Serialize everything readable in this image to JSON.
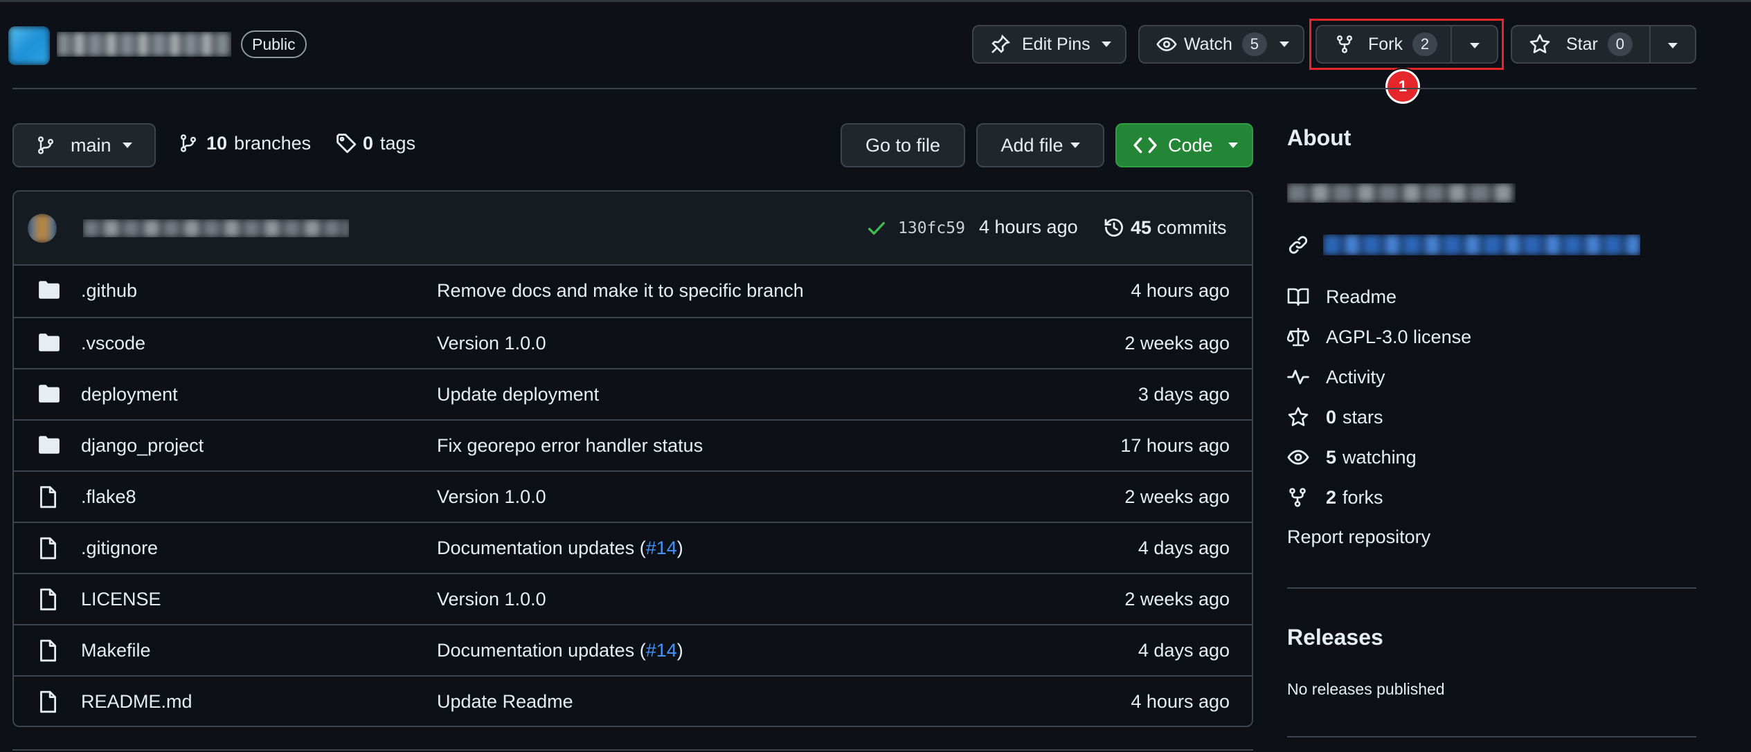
{
  "repo": {
    "visibility": "Public"
  },
  "header_actions": {
    "edit_pins": "Edit Pins",
    "watch": "Watch",
    "watch_count": "5",
    "fork": "Fork",
    "fork_count": "2",
    "star": "Star",
    "star_count": "0"
  },
  "annotation_marker": "1",
  "toolbar": {
    "branch": "main",
    "branches_count": "10",
    "branches_label": "branches",
    "tags_count": "0",
    "tags_label": "tags",
    "go_to_file": "Go to file",
    "add_file": "Add file",
    "code": "Code"
  },
  "commit": {
    "hash": "130fc59",
    "time": "4 hours ago",
    "commits_count": "45",
    "commits_label": "commits"
  },
  "files": [
    {
      "type": "dir",
      "name": ".github",
      "message": "Remove docs and make it to specific branch",
      "message_link": "",
      "message_end": "",
      "time": "4 hours ago"
    },
    {
      "type": "dir",
      "name": ".vscode",
      "message": "Version 1.0.0",
      "message_link": "",
      "message_end": "",
      "time": "2 weeks ago"
    },
    {
      "type": "dir",
      "name": "deployment",
      "message": "Update deployment",
      "message_link": "",
      "message_end": "",
      "time": "3 days ago"
    },
    {
      "type": "dir",
      "name": "django_project",
      "message": "Fix georepo error handler status",
      "message_link": "",
      "message_end": "",
      "time": "17 hours ago"
    },
    {
      "type": "file",
      "name": ".flake8",
      "message": "Version 1.0.0",
      "message_link": "",
      "message_end": "",
      "time": "2 weeks ago"
    },
    {
      "type": "file",
      "name": ".gitignore",
      "message": "Documentation updates (",
      "message_link": "#14",
      "message_end": ")",
      "time": "4 days ago"
    },
    {
      "type": "file",
      "name": "LICENSE",
      "message": "Version 1.0.0",
      "message_link": "",
      "message_end": "",
      "time": "2 weeks ago"
    },
    {
      "type": "file",
      "name": "Makefile",
      "message": "Documentation updates (",
      "message_link": "#14",
      "message_end": ")",
      "time": "4 days ago"
    },
    {
      "type": "file",
      "name": "README.md",
      "message": "Update Readme",
      "message_link": "",
      "message_end": "",
      "time": "4 hours ago"
    }
  ],
  "about": {
    "title": "About",
    "readme": "Readme",
    "license": "AGPL-3.0 license",
    "activity": "Activity",
    "stars_count": "0",
    "stars_label": "stars",
    "watching_count": "5",
    "watching_label": "watching",
    "forks_count": "2",
    "forks_label": "forks",
    "report": "Report repository"
  },
  "releases": {
    "title": "Releases",
    "empty": "No releases published"
  },
  "colors": {
    "background": "#0d1117",
    "border": "#3d444d",
    "code_button": "#238636",
    "link": "#4493f8",
    "highlight": "#e5262a"
  }
}
